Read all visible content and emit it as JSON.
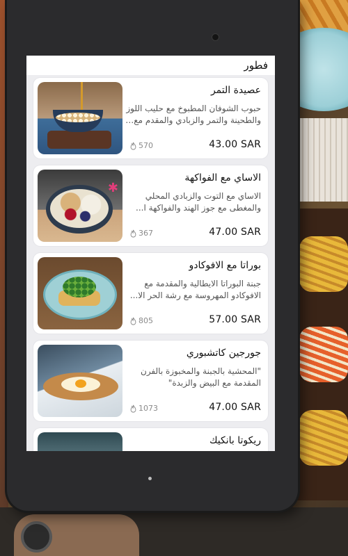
{
  "screen": {
    "title": "فطور"
  },
  "currency": "SAR",
  "items": [
    {
      "name": "عصيدة التمر",
      "description": "حبوب الشوفان المطبوخ مع حليب اللوز والطحينة والتمر والزبادي والمقدم مع الـ...",
      "price": "43.00 SAR",
      "calories": "570"
    },
    {
      "name": "الاساي مع الفواكهة",
      "description": "الاساي مع التوت والزبادي المحلي والمغطى مع جوز الهند والفواكهة ا...",
      "price": "47.00 SAR",
      "calories": "367"
    },
    {
      "name": "بوراتا مع الافوكادو",
      "description": "جبنة البوراتا الايطالية والمقدمة مع الافوكادو المهروسة مع رشة الحر الا...",
      "price": "57.00 SAR",
      "calories": "805"
    },
    {
      "name": "جورجين كاتشبوري",
      "description": "\"المحشية بالجبنة والمخبوزة بالفرن المقدمة مع البيض والزبدة\"",
      "price": "47.00 SAR",
      "calories": "1073"
    },
    {
      "name": "ريكوتا بانكيك"
    }
  ]
}
